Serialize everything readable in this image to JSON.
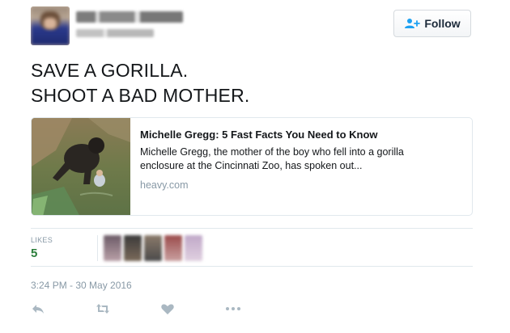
{
  "header": {
    "follow_label": "Follow"
  },
  "tweet": {
    "text_line1": "SAVE A GORILLA.",
    "text_line2": "SHOOT A BAD MOTHER.",
    "timestamp": "3:24 PM - 30 May 2016"
  },
  "card": {
    "title": "Michelle Gregg: 5 Fast Facts You Need to Know",
    "description_line1": "Michelle Gregg, the mother of the boy who fell into a gorilla",
    "description_line2": "enclosure at the Cincinnati Zoo, has spoken out...",
    "domain": "heavy.com"
  },
  "stats": {
    "likes_label": "LIKES",
    "likes_count": "5"
  },
  "icons": {
    "follow": "add-user-icon",
    "reply": "reply-icon",
    "retweet": "retweet-icon",
    "like": "heart-icon",
    "more": "more-dots-icon"
  },
  "colors": {
    "link_gray": "#8899a6",
    "likes_green": "#2a7d3a",
    "follow_blue": "#1da1f2"
  }
}
